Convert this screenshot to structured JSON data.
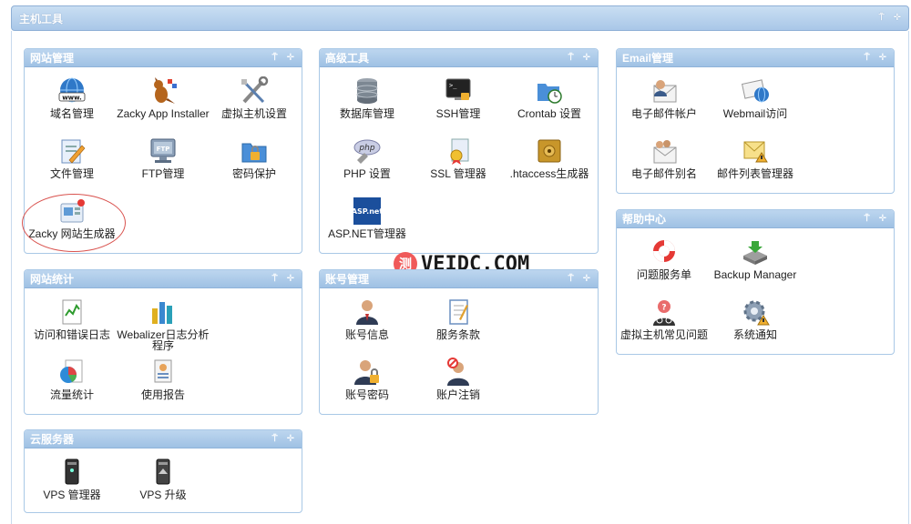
{
  "main": {
    "title": "主机工具"
  },
  "panels": {
    "site_mgmt": {
      "title": "网站管理",
      "items": [
        "域名管理",
        "Zacky App Installer",
        "虚拟主机设置",
        "文件管理",
        "FTP管理",
        "密码保护",
        "Zacky 网站生成器"
      ]
    },
    "advanced": {
      "title": "高级工具",
      "items": [
        "数据库管理",
        "SSH管理",
        "Crontab 设置",
        "PHP 设置",
        "SSL 管理器",
        ".htaccess生成器",
        "ASP.NET管理器"
      ]
    },
    "email": {
      "title": "Email管理",
      "items": [
        "电子邮件帐户",
        "Webmail访问",
        "电子邮件别名",
        "邮件列表管理器"
      ]
    },
    "help": {
      "title": "帮助中心",
      "items": [
        "问题服务单",
        "Backup Manager",
        "虚拟主机常见问题",
        "系统通知"
      ]
    },
    "stats": {
      "title": "网站统计",
      "items": [
        "访问和错误日志",
        "Webalizer日志分析程序",
        "流量统计",
        "使用报告"
      ]
    },
    "account": {
      "title": "账号管理",
      "items": [
        "账号信息",
        "服务条款",
        "账号密码",
        "账户注销"
      ]
    },
    "cloud": {
      "title": "云服务器",
      "items": [
        "VPS 管理器",
        "VPS 升级"
      ]
    }
  },
  "controls": {
    "pin": "⍑",
    "move": "✛"
  },
  "watermark": {
    "badge": "测",
    "text": "VEIDC.COM"
  },
  "colors": {
    "header_blue": "#a9c7e8",
    "border": "#a9c8e6",
    "annotation": "#d9534f"
  },
  "icons": [
    "globe-icon",
    "kangaroo-icon",
    "tools-icon",
    "file-edit-icon",
    "ftp-monitor-icon",
    "lock-folder-icon",
    "site-builder-icon",
    "database-icon",
    "terminal-icon",
    "clock-globe-icon",
    "php-icon",
    "certificate-icon",
    "safe-icon",
    "aspnet-icon",
    "email-user-icon",
    "webmail-icon",
    "email-alias-icon",
    "mail-list-icon",
    "lifebuoy-icon",
    "backup-icon",
    "help-user-icon",
    "gear-notice-icon",
    "log-chart-icon",
    "bar-chart-icon",
    "pie-chart-icon",
    "report-icon",
    "user-info-icon",
    "terms-icon",
    "user-lock-icon",
    "user-cancel-icon",
    "server-icon",
    "server-upgrade-icon"
  ]
}
